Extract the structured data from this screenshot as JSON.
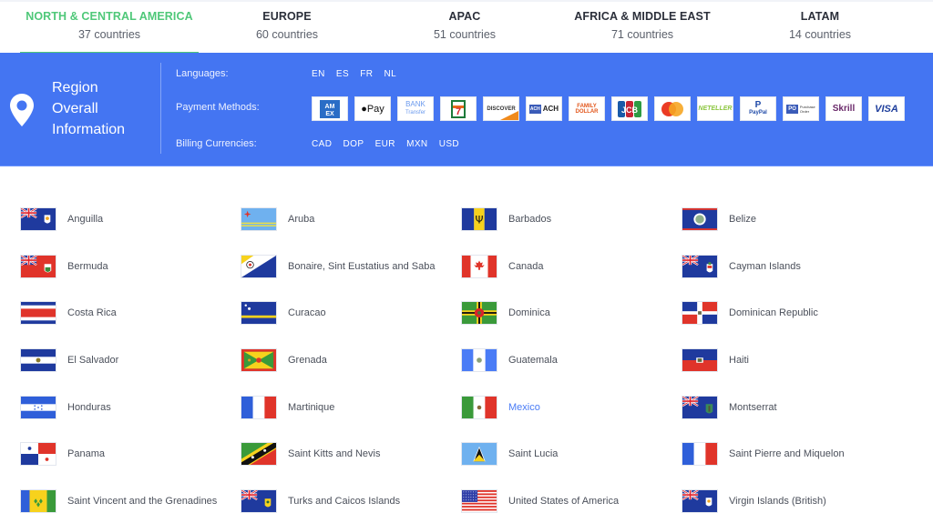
{
  "tabs": [
    {
      "title": "NORTH & CENTRAL AMERICA",
      "count": "37 countries",
      "active": true
    },
    {
      "title": "EUROPE",
      "count": "60 countries",
      "active": false
    },
    {
      "title": "APAC",
      "count": "51 countries",
      "active": false
    },
    {
      "title": "AFRICA & MIDDLE EAST",
      "count": "71 countries",
      "active": false
    },
    {
      "title": "LATAM",
      "count": "14 countries",
      "active": false
    }
  ],
  "colors": {
    "accent_green": "#4fc879",
    "band_blue": "#4475f2",
    "link_blue": "#4a7cf6"
  },
  "region_info": {
    "icon": "map-pin-icon",
    "title_lines": [
      "Region",
      "Overall",
      "Information"
    ],
    "languages_label": "Languages:",
    "languages": [
      "EN",
      "ES",
      "FR",
      "NL"
    ],
    "payment_label": "Payment Methods:",
    "payment_methods": [
      {
        "name": "amex",
        "label": "AM EX"
      },
      {
        "name": "apple-pay",
        "label": "Pay"
      },
      {
        "name": "bank-transfer",
        "label": "BANK Transfer"
      },
      {
        "name": "7-eleven",
        "label": "7"
      },
      {
        "name": "discover",
        "label": "DISCOVER"
      },
      {
        "name": "ach",
        "label": "ACH"
      },
      {
        "name": "family-dollar",
        "label": "FAMILY DOLLAR"
      },
      {
        "name": "jcb",
        "label": "JCB"
      },
      {
        "name": "mastercard",
        "label": ""
      },
      {
        "name": "neteller",
        "label": "NETELLER"
      },
      {
        "name": "paypal",
        "label": "PayPal"
      },
      {
        "name": "purchase-order",
        "label": "Purchase Order"
      },
      {
        "name": "skrill",
        "label": "Skrill"
      },
      {
        "name": "visa",
        "label": "VISA"
      }
    ],
    "billing_label": "Billing Currencies:",
    "currencies": [
      "CAD",
      "DOP",
      "EUR",
      "MXN",
      "USD"
    ]
  },
  "countries": [
    {
      "name": "Anguilla",
      "flag": "anguilla"
    },
    {
      "name": "Aruba",
      "flag": "aruba"
    },
    {
      "name": "Barbados",
      "flag": "barbados"
    },
    {
      "name": "Belize",
      "flag": "belize"
    },
    {
      "name": "Bermuda",
      "flag": "bermuda"
    },
    {
      "name": "Bonaire, Sint Eustatius and Saba",
      "flag": "bonaire"
    },
    {
      "name": "Canada",
      "flag": "canada"
    },
    {
      "name": "Cayman Islands",
      "flag": "cayman"
    },
    {
      "name": "Costa Rica",
      "flag": "costa-rica"
    },
    {
      "name": "Curacao",
      "flag": "curacao"
    },
    {
      "name": "Dominica",
      "flag": "dominica"
    },
    {
      "name": "Dominican Republic",
      "flag": "dominican-republic"
    },
    {
      "name": "El Salvador",
      "flag": "el-salvador"
    },
    {
      "name": "Grenada",
      "flag": "grenada"
    },
    {
      "name": "Guatemala",
      "flag": "guatemala"
    },
    {
      "name": "Haiti",
      "flag": "haiti"
    },
    {
      "name": "Honduras",
      "flag": "honduras"
    },
    {
      "name": "Martinique",
      "flag": "martinique"
    },
    {
      "name": "Mexico",
      "flag": "mexico",
      "highlight": true
    },
    {
      "name": "Montserrat",
      "flag": "montserrat"
    },
    {
      "name": "Panama",
      "flag": "panama"
    },
    {
      "name": "Saint Kitts and Nevis",
      "flag": "saint-kitts"
    },
    {
      "name": "Saint Lucia",
      "flag": "saint-lucia"
    },
    {
      "name": "Saint Pierre and Miquelon",
      "flag": "saint-pierre"
    },
    {
      "name": "Saint Vincent and the Grenadines",
      "flag": "saint-vincent"
    },
    {
      "name": "Turks and Caicos Islands",
      "flag": "turks-caicos"
    },
    {
      "name": "United States of America",
      "flag": "usa"
    },
    {
      "name": "Virgin Islands (British)",
      "flag": "bvi"
    }
  ]
}
